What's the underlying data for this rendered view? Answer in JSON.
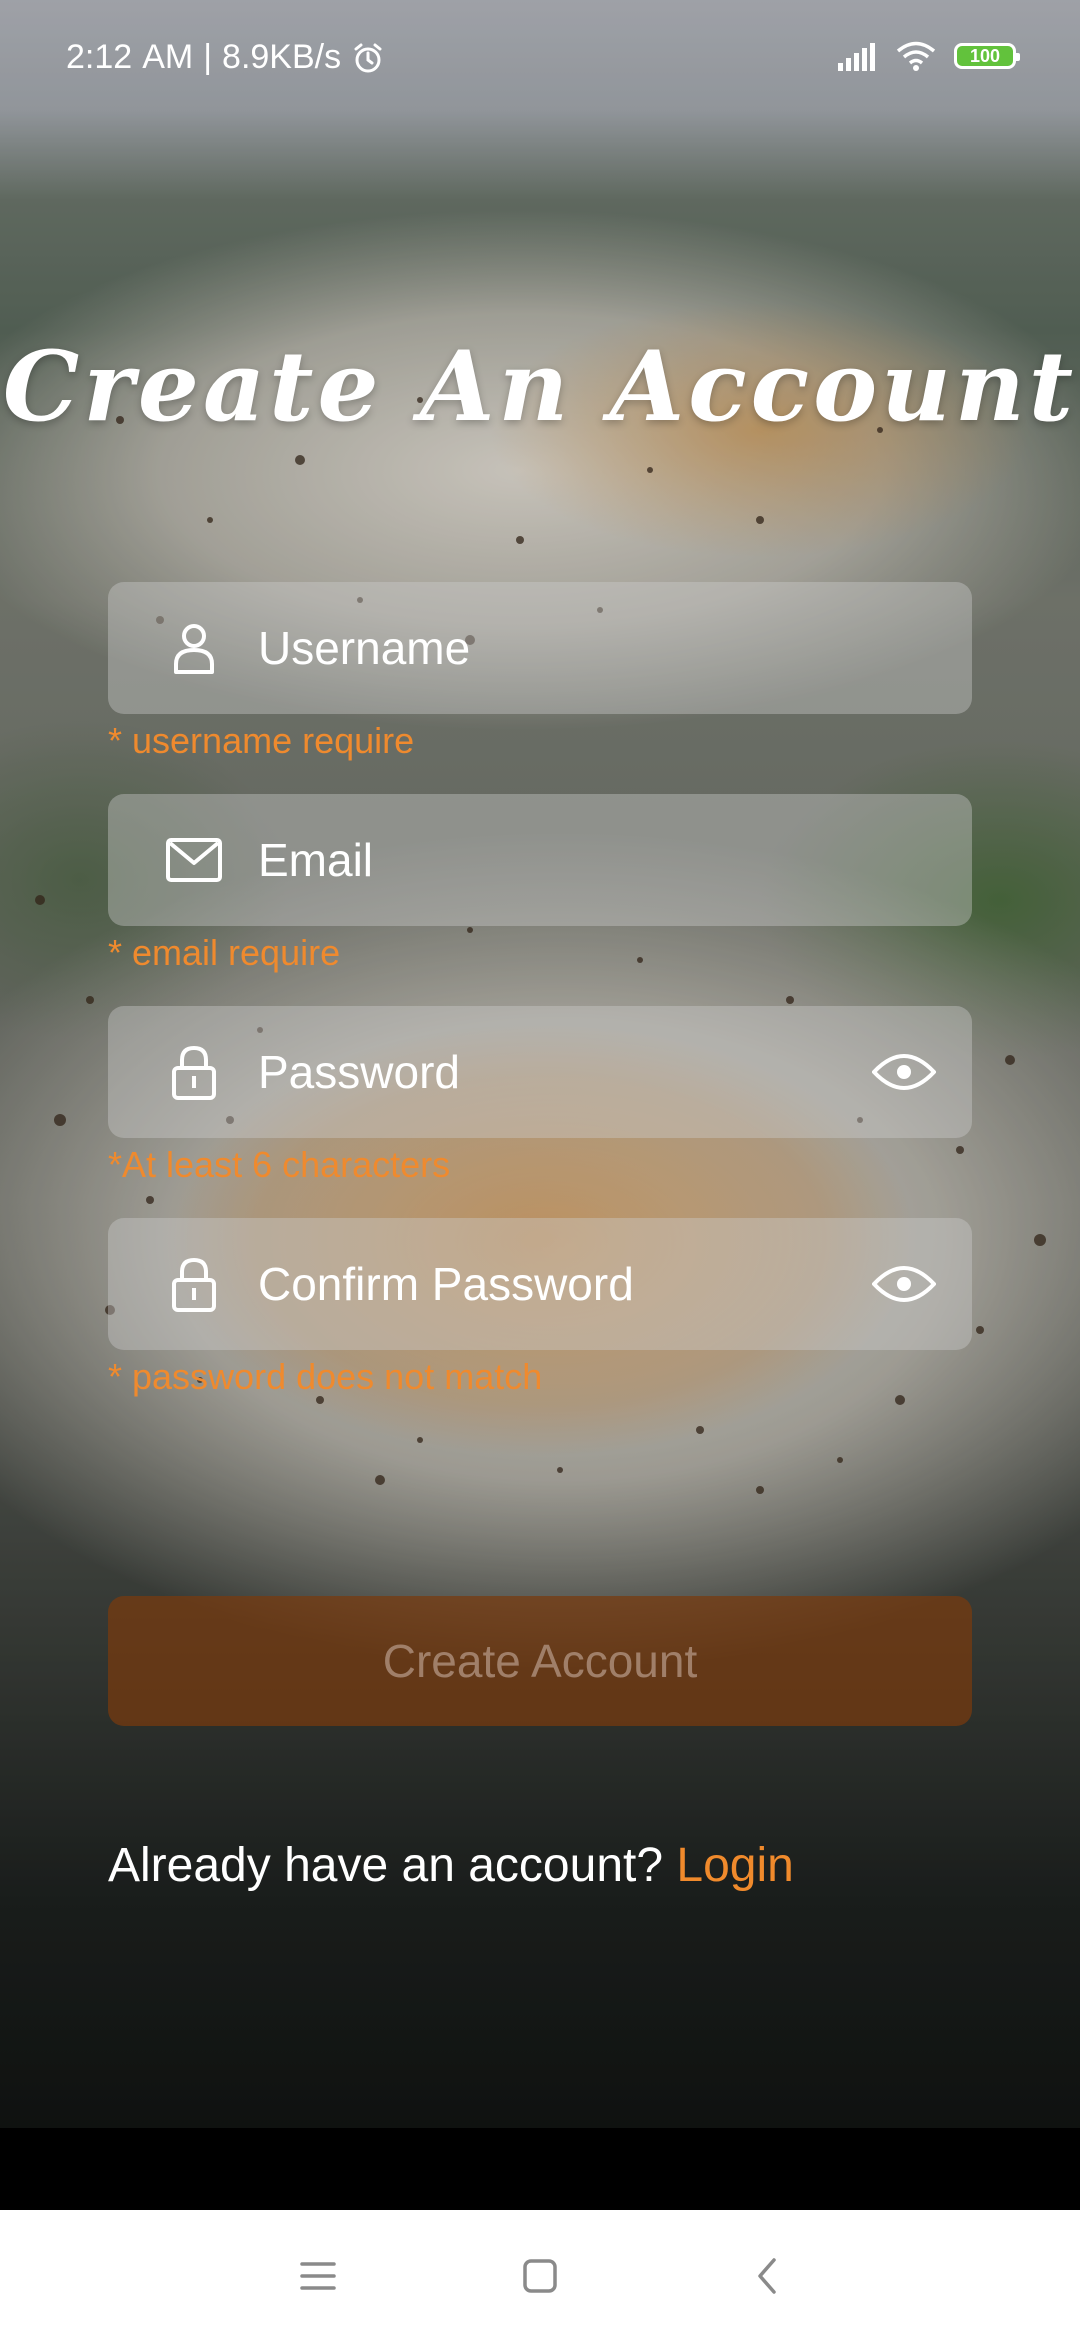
{
  "status_bar": {
    "time": "2:12",
    "ampm": "AM",
    "separator": "|",
    "net_speed": "8.9KB/s",
    "battery_level": "100",
    "battery_color": "#62c23c"
  },
  "page": {
    "title": "Create An Account"
  },
  "form": {
    "username": {
      "placeholder": "Username",
      "error": "* username require",
      "icon": "user-icon"
    },
    "email": {
      "placeholder": "Email",
      "error": "* email require",
      "icon": "envelope-icon"
    },
    "password": {
      "placeholder": "Password",
      "error": "*At least 6 characters",
      "icon": "lock-icon",
      "toggle_icon": "eye-icon"
    },
    "confirm_password": {
      "placeholder": "Confirm Password",
      "error": "* password does not match",
      "icon": "lock-icon",
      "toggle_icon": "eye-icon"
    }
  },
  "actions": {
    "create_account_label": "Create Account",
    "already_text": "Already have an account?",
    "login_label": "Login"
  },
  "colors": {
    "accent": "#ef8a2e",
    "button_bg": "#783a0e"
  },
  "navigation": {
    "items": [
      "menu-icon",
      "home-square-icon",
      "back-chevron-icon"
    ]
  }
}
